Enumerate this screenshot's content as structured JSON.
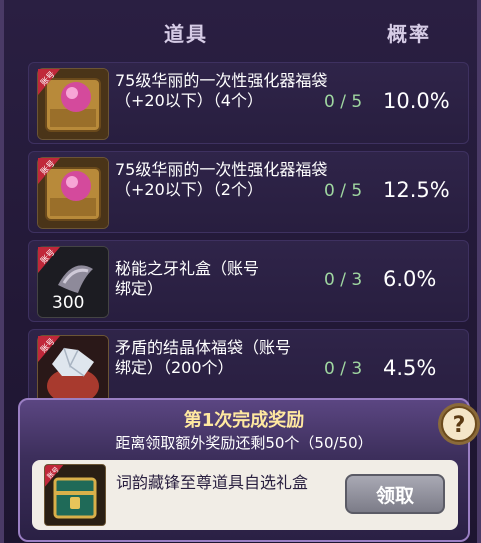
{
  "header": {
    "item_col": "道具",
    "rate_col": "概率"
  },
  "bound_tag": "账号",
  "items": [
    {
      "name": "75级华丽的一次性强化器福袋（+20以下）（4个）",
      "count": "0 / 5",
      "rate": "10.0%",
      "icon": "pink-orb-box-icon",
      "qty": ""
    },
    {
      "name": "75级华丽的一次性强化器福袋（+20以下）（2个）",
      "count": "0 / 5",
      "rate": "12.5%",
      "icon": "pink-orb-box-icon",
      "qty": ""
    },
    {
      "name": "秘能之牙礼盒（账号绑定）",
      "count": "0 / 3",
      "rate": "6.0%",
      "icon": "fang-icon",
      "qty": "300"
    },
    {
      "name": "矛盾的结晶体福袋（账号绑定）（200个）",
      "count": "0 / 3",
      "rate": "4.5%",
      "icon": "crystal-bag-icon",
      "qty": ""
    }
  ],
  "reward": {
    "title": "第1次完成奖励",
    "subtitle": "距离领取额外奖励还剩50个（50/50）",
    "item_name": "词韵藏锋至尊道具自选礼盒",
    "claim_label": "领取"
  },
  "help_symbol": "?"
}
